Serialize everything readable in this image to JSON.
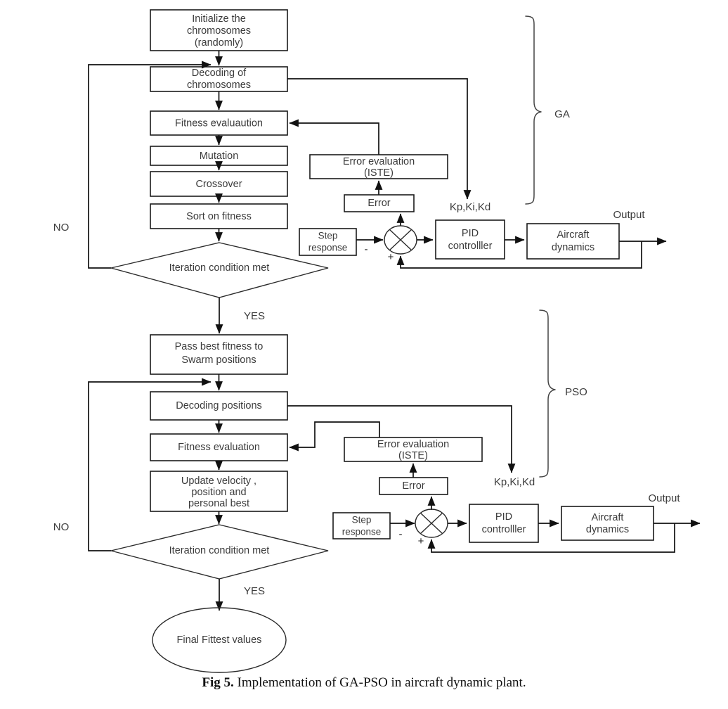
{
  "figure": {
    "caption_number": "Fig 5.",
    "caption_text": "Implementation of GA-PSO in aircraft dynamic plant."
  },
  "ga_section": {
    "brace_label": "GA",
    "nodes": {
      "initialize": "Initialize the\nchromosomes\n(randomly)",
      "initialize_line1": "Initialize the",
      "initialize_line2": "chromosomes",
      "initialize_line3": "(randomly)",
      "decoding_line1": "Decoding of",
      "decoding_line2": "chromosomes",
      "fitness": "Fitness evaluaution",
      "mutation": "Mutation",
      "crossover": "Crossover",
      "sort": "Sort on fitness",
      "decision": "Iteration condition met",
      "error_eval_line1": "Error evaluation",
      "error_eval_line2": "(ISTE)",
      "error": "Error",
      "step_line1": "Step",
      "step_line2": "response",
      "pid_line1": "PID",
      "pid_line2": "controlller",
      "aircraft_line1": "Aircraft",
      "aircraft_line2": "dynamics"
    },
    "labels": {
      "no": "NO",
      "yes": "YES",
      "gains": "Kp,Ki,Kd",
      "output": "Output",
      "minus": "-",
      "plus": "+"
    }
  },
  "pso_section": {
    "brace_label": "PSO",
    "nodes": {
      "pass_best_line1": "Pass best fitness to",
      "pass_best_line2": "Swarm positions",
      "decoding": "Decoding positions",
      "fitness": "Fitness evaluation",
      "update_line1": "Update velocity ,",
      "update_line2": "position and",
      "update_line3": "personal best",
      "decision": "Iteration condition met",
      "error_eval_line1": "Error evaluation",
      "error_eval_line2": "(ISTE)",
      "error": "Error",
      "step_line1": "Step",
      "step_line2": "response",
      "pid_line1": "PID",
      "pid_line2": "controlller",
      "aircraft_line1": "Aircraft",
      "aircraft_line2": "dynamics",
      "final": "Final Fittest values"
    },
    "labels": {
      "no": "NO",
      "yes": "YES",
      "gains": "Kp,Ki,Kd",
      "output": "Output",
      "minus": "-",
      "plus": "+"
    }
  },
  "colors": {
    "line": "#111111",
    "box_stroke": "#1a1a1a",
    "text": "#3b3b3b",
    "background": "#ffffff"
  }
}
